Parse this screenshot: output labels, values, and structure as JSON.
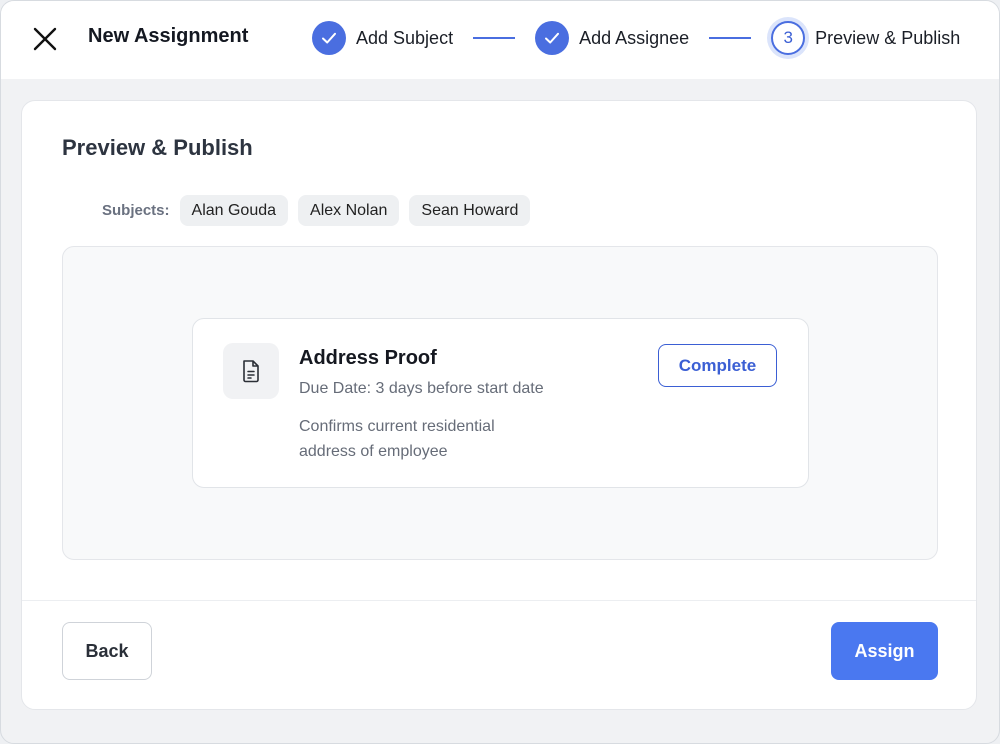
{
  "header": {
    "title": "New Assignment",
    "steps": [
      {
        "label": "Add Subject",
        "state": "done"
      },
      {
        "label": "Add Assignee",
        "state": "done"
      },
      {
        "label": "Preview & Publish",
        "number": "3",
        "state": "current"
      }
    ]
  },
  "content": {
    "title": "Preview & Publish",
    "subjects_label": "Subjects:",
    "subjects": [
      "Alan Gouda",
      "Alex Nolan",
      "Sean Howard"
    ],
    "task": {
      "icon": "document-icon",
      "title": "Address Proof",
      "due": "Due Date: 3 days before start date",
      "description": "Confirms current residential address of employee",
      "action_label": "Complete"
    }
  },
  "footer": {
    "back_label": "Back",
    "assign_label": "Assign"
  },
  "colors": {
    "accent": "#4a6ee0",
    "primary_button": "#4a78f0"
  }
}
